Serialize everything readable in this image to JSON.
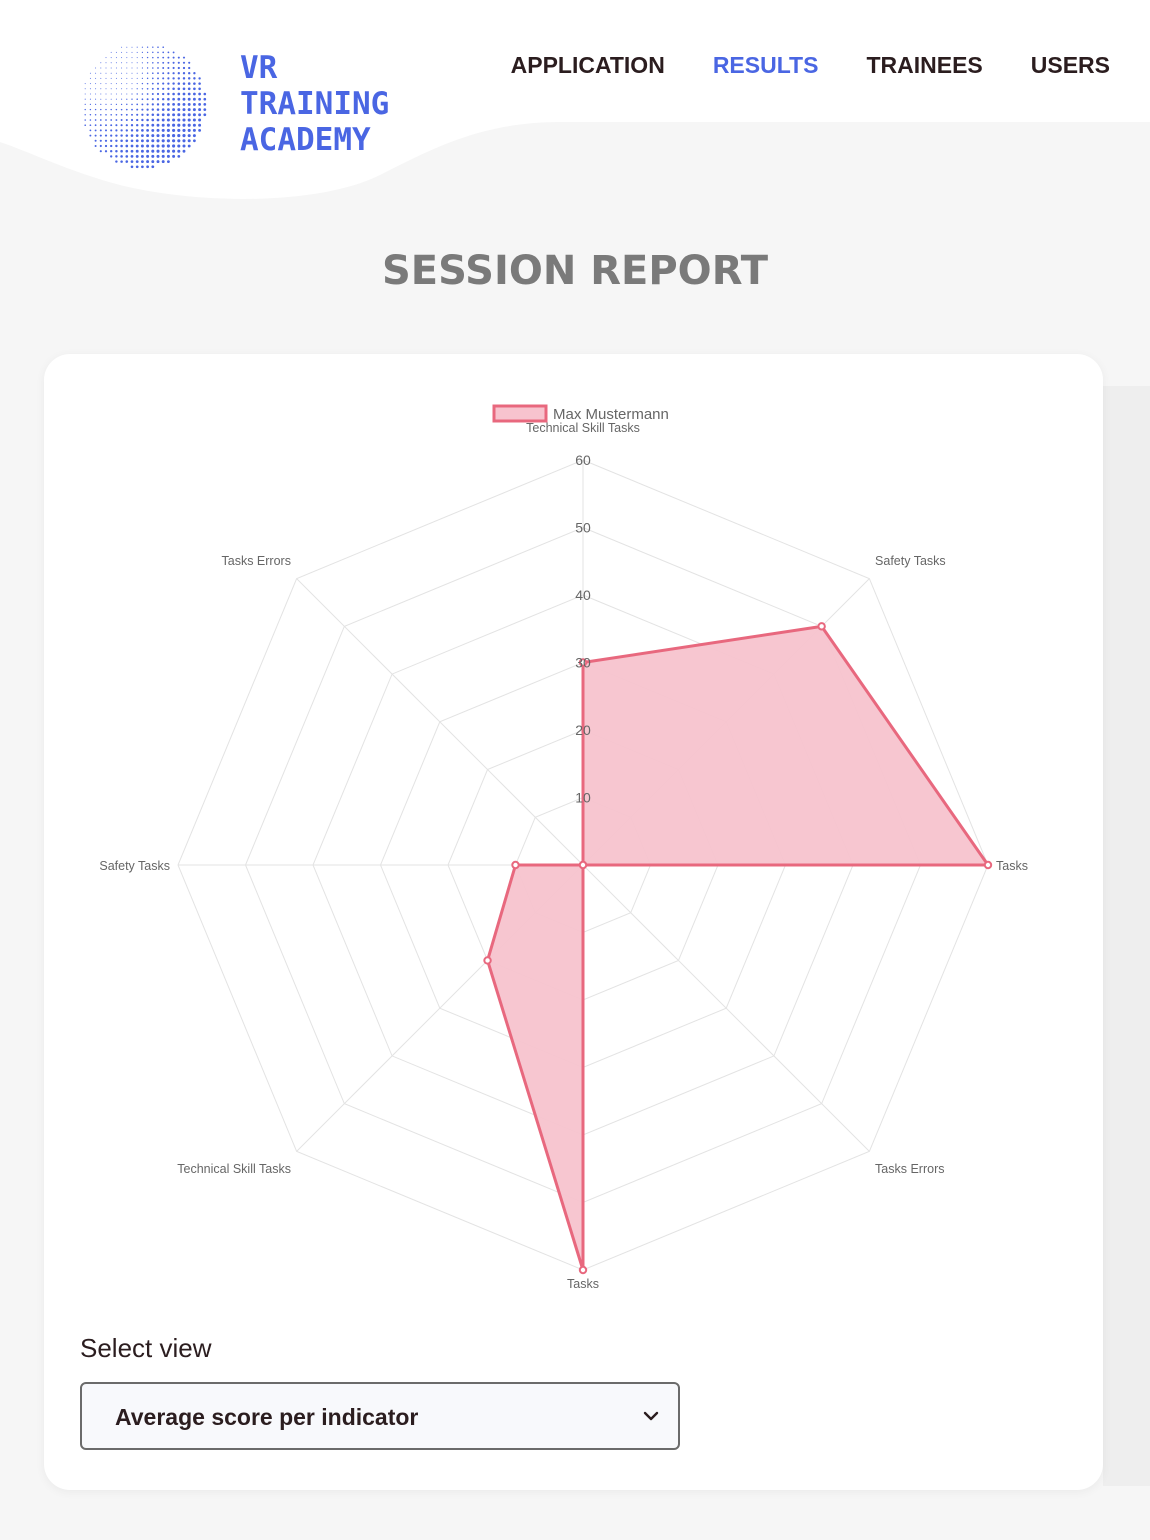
{
  "brand": {
    "lines": [
      "VR",
      "TRAINING",
      "ACADEMY"
    ],
    "color": "#4a66e3"
  },
  "nav": {
    "items": [
      {
        "label": "APPLICATION",
        "active": false
      },
      {
        "label": "RESULTS",
        "active": true
      },
      {
        "label": "TRAINEES",
        "active": false
      },
      {
        "label": "USERS",
        "active": false
      }
    ],
    "active_color": "#4a66e3",
    "text_color": "#2b1d1f"
  },
  "page": {
    "title": "SESSION REPORT"
  },
  "select": {
    "label": "Select view",
    "value": "Average score per indicator",
    "icon": "chevron-down-icon"
  },
  "chart_data": {
    "type": "radar",
    "legend": "top",
    "grid": true,
    "rlim": [
      0,
      60
    ],
    "ticks": [
      10,
      20,
      30,
      40,
      50,
      60
    ],
    "axes": [
      "Technical Skill Tasks",
      "Safety Tasks",
      "Tasks",
      "Tasks Errors",
      "Tasks",
      "Technical Skill Tasks",
      "Safety Tasks",
      "Tasks Errors"
    ],
    "series": [
      {
        "name": "Max Mustermann",
        "values": [
          30,
          50,
          60,
          0,
          60,
          20,
          10,
          0
        ],
        "stroke": "#e8687e",
        "fill": "#f7c3ce"
      }
    ]
  }
}
